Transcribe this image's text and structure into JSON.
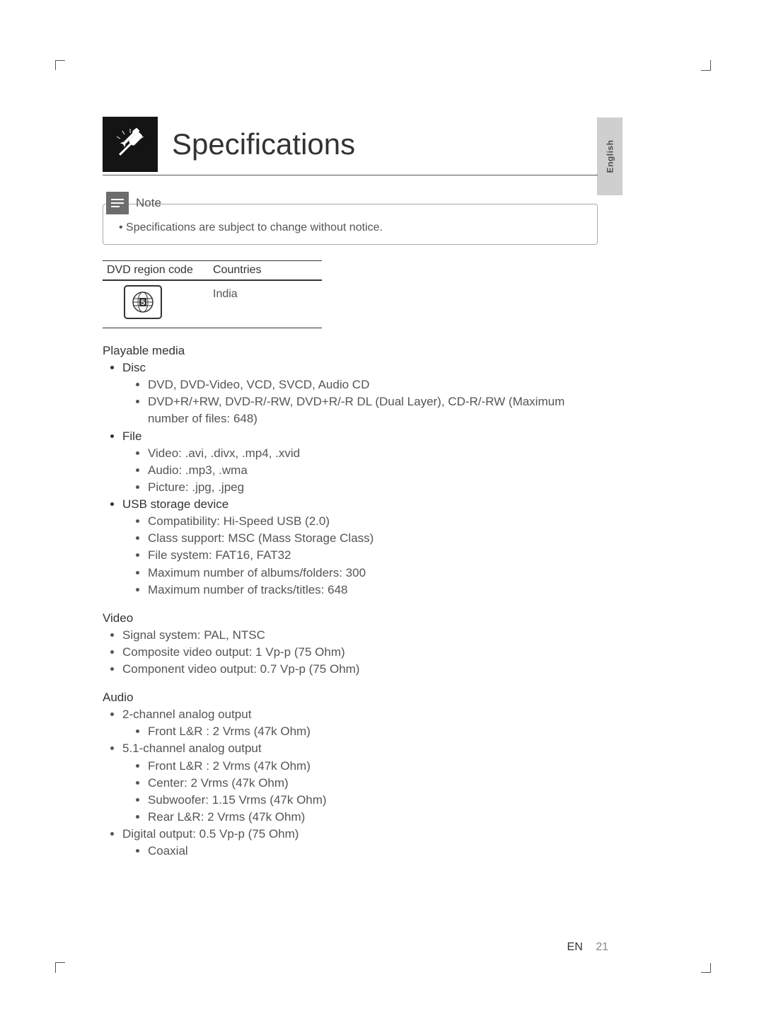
{
  "language_tab": "English",
  "title": "Specifications",
  "note": {
    "label": "Note",
    "text": "Specifications are subject to change without notice."
  },
  "region_table": {
    "headers": {
      "code": "DVD region code",
      "countries": "Countries"
    },
    "row": {
      "region_number": "5",
      "countries": "India"
    }
  },
  "sections": {
    "playable_media": {
      "heading": "Playable media",
      "disc_label": "Disc",
      "disc_items": {
        "a": "DVD, DVD-Video, VCD, SVCD, Audio CD",
        "b": "DVD+R/+RW, DVD-R/-RW, DVD+R/-R DL (Dual Layer), CD-R/-RW (Maximum number of files: 648)"
      },
      "file_label": "File",
      "file_items": {
        "a": "Video: .avi, .divx, .mp4, .xvid",
        "b": "Audio: .mp3, .wma",
        "c": "Picture: .jpg, .jpeg"
      },
      "usb_label": "USB storage device",
      "usb_items": {
        "a": "Compatibility: Hi-Speed USB (2.0)",
        "b": "Class support: MSC (Mass Storage Class)",
        "c": "File system: FAT16, FAT32",
        "d": "Maximum number of albums/folders: 300",
        "e": "Maximum number of tracks/titles: 648"
      }
    },
    "video": {
      "heading": "Video",
      "items": {
        "a": "Signal system: PAL, NTSC",
        "b": "Composite video output: 1 Vp-p (75 Ohm)",
        "c": "Component video output: 0.7 Vp-p (75 Ohm)"
      }
    },
    "audio": {
      "heading": "Audio",
      "two_ch_label": "2-channel analog output",
      "two_ch_items": {
        "a": "Front L&R : 2 Vrms (47k Ohm)"
      },
      "five_ch_label": "5.1-channel analog output",
      "five_ch_items": {
        "a": "Front L&R : 2 Vrms (47k Ohm)",
        "b": "Center: 2 Vrms (47k Ohm)",
        "c": "Subwoofer: 1.15 Vrms (47k Ohm)",
        "d": "Rear L&R: 2 Vrms (47k Ohm)"
      },
      "digital_label": "Digital output: 0.5 Vp-p (75 Ohm)",
      "digital_items": {
        "a": "Coaxial"
      }
    }
  },
  "footer": {
    "lang": "EN",
    "page": "21"
  }
}
